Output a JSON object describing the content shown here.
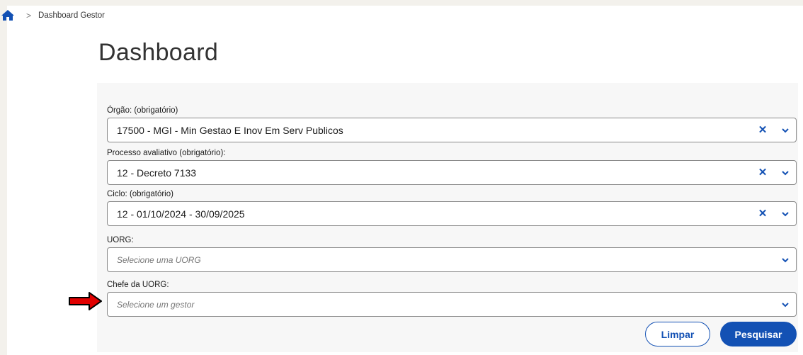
{
  "breadcrumb": {
    "home_icon": "home-icon",
    "separator": ">",
    "current": "Dashboard Gestor"
  },
  "page": {
    "title": "Dashboard"
  },
  "form": {
    "orgao": {
      "label": "Órgão: (obrigatório)",
      "value": "17500 - MGI - Min Gestao E Inov Em Serv Publicos"
    },
    "processo": {
      "label": "Processo avaliativo (obrigatório):",
      "value": "12 - Decreto 7133"
    },
    "ciclo": {
      "label": "Ciclo: (obrigatório)",
      "value": "12 - 01/10/2024 - 30/09/2025"
    },
    "uorg": {
      "label": "UORG:",
      "placeholder": "Selecione uma UORG"
    },
    "chefe": {
      "label": "Chefe da UORG:",
      "placeholder": "Selecione um gestor"
    }
  },
  "buttons": {
    "clear": "Limpar",
    "search": "Pesquisar"
  },
  "colors": {
    "primary": "#1351b4",
    "annotation_arrow": "#e00000",
    "background": "#f3f1ec"
  }
}
